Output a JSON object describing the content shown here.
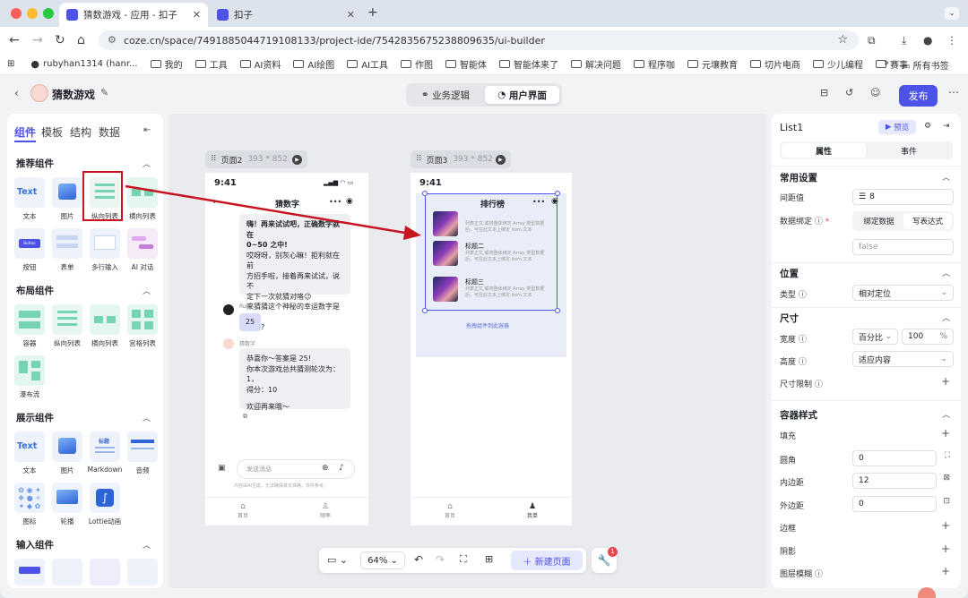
{
  "browser": {
    "tabs": [
      {
        "title": "猜数游戏 - 应用 - 扣子"
      },
      {
        "title": "扣子"
      }
    ],
    "url": "coze.cn/space/7491885044719108133/project-ide/7542835675238809635/ui-builder",
    "bookmarks": [
      "rubyhan1314 (hanr...",
      "我的",
      "工具",
      "AI资料",
      "AI绘图",
      "AI工具",
      "作图",
      "智能体",
      "智能体来了",
      "解决问题",
      "程序咖",
      "元壤教育",
      "切片电商",
      "少儿编程",
      "赛事"
    ],
    "all_bookmarks": "所有书签"
  },
  "app": {
    "project_name": "猜数游戏",
    "mode_tabs": [
      "业务逻辑",
      "用户界面"
    ],
    "publish": "发布"
  },
  "left_panel": {
    "tabs": [
      "组件",
      "模板",
      "结构",
      "数据"
    ],
    "sections": [
      {
        "title": "推荐组件",
        "items": [
          "文本",
          "图片",
          "纵向列表",
          "横向列表",
          "按钮",
          "表单",
          "多行输入",
          "AI 对话"
        ]
      },
      {
        "title": "布局组件",
        "items": [
          "容器",
          "纵向列表",
          "横向列表",
          "宫格列表",
          "瀑布流"
        ]
      },
      {
        "title": "展示组件",
        "items": [
          "文本",
          "图片",
          "Markdown",
          "音频",
          "图标",
          "轮播",
          "Lottie动画"
        ]
      },
      {
        "title": "输入组件",
        "items": []
      }
    ],
    "icon_texts": {
      "text": "Text",
      "button": "Button",
      "md_title": "标题"
    }
  },
  "canvas": {
    "pages": [
      {
        "name": "页面2",
        "size": "393 * 852"
      },
      {
        "name": "页面3",
        "size": "393 * 852"
      }
    ],
    "phone1": {
      "time": "9:41",
      "title": "猜数字",
      "bot_msg1": [
        "嗨！再来试试吧，正确数字就在",
        "0~50 之中!",
        "哎呀呀，别灰心嘛！拒利就在前",
        "方招手啦，接着再来试试，说不",
        "定下一次就猜对咯😉",
        "来猜猜这个神秘的幸运数字是多",
        "少吧?"
      ],
      "user_name": "Ruby",
      "user_msg": "25",
      "bot_name": "猜数字",
      "bot_msg2": [
        "恭喜你～答案是 25!",
        "你本次游戏总共猜测轮次为：1，",
        "得分：10",
        "",
        "欢迎再来哦～"
      ],
      "input_placeholder": "发送消息",
      "disclaimer": "内容由AI生成，无法确保真实准确，仅供参考。",
      "tabbar": [
        "首页",
        "频率"
      ]
    },
    "phone2": {
      "time": "9:41",
      "title": "排行榜",
      "items": [
        {
          "title": "",
          "desc": "列表正文,或将整体绑定 Array 类型数据后，可在此文本上绑定 item.文本"
        },
        {
          "title": "标题二",
          "desc": "列表正文,或将整体绑定 Array 类型数据后，可在此文本上绑定 item.文本"
        },
        {
          "title": "标题三",
          "desc": "列表正文,或将整体绑定 Array 类型数据后，可在此文本上绑定 item.文本"
        }
      ],
      "drop_hint": "拖拽组件到此容器",
      "tabbar": [
        "首页",
        "我单"
      ]
    },
    "toolbar": {
      "zoom": "64%",
      "new_page": "新建页面",
      "badge": "1"
    }
  },
  "right_panel": {
    "component": "List1",
    "preview": "预览",
    "tabs": [
      "属性",
      "事件"
    ],
    "common": {
      "title": "常用设置",
      "gap_label": "间距值",
      "gap_value": "8",
      "binding_label": "数据绑定",
      "bind_options": [
        "绑定数据",
        "写表达式"
      ],
      "bind_value": "false"
    },
    "position": {
      "title": "位置",
      "type_label": "类型",
      "type_value": "相对定位"
    },
    "size": {
      "title": "尺寸",
      "width_label": "宽度",
      "width_unit": "百分比",
      "width_value": "100",
      "width_suffix": "%",
      "height_label": "高度",
      "height_value": "适应内容",
      "limit_label": "尺寸限制"
    },
    "style": {
      "title": "容器样式",
      "fill": "填充",
      "radius": "圆角",
      "radius_value": "0",
      "padding": "内边距",
      "padding_value": "12",
      "margin": "外边距",
      "margin_value": "0",
      "border": "边框",
      "shadow": "阴影",
      "blur": "图层模糊"
    }
  },
  "colors": {
    "accent": "#4d53e8",
    "highlight": "#c8141e"
  }
}
